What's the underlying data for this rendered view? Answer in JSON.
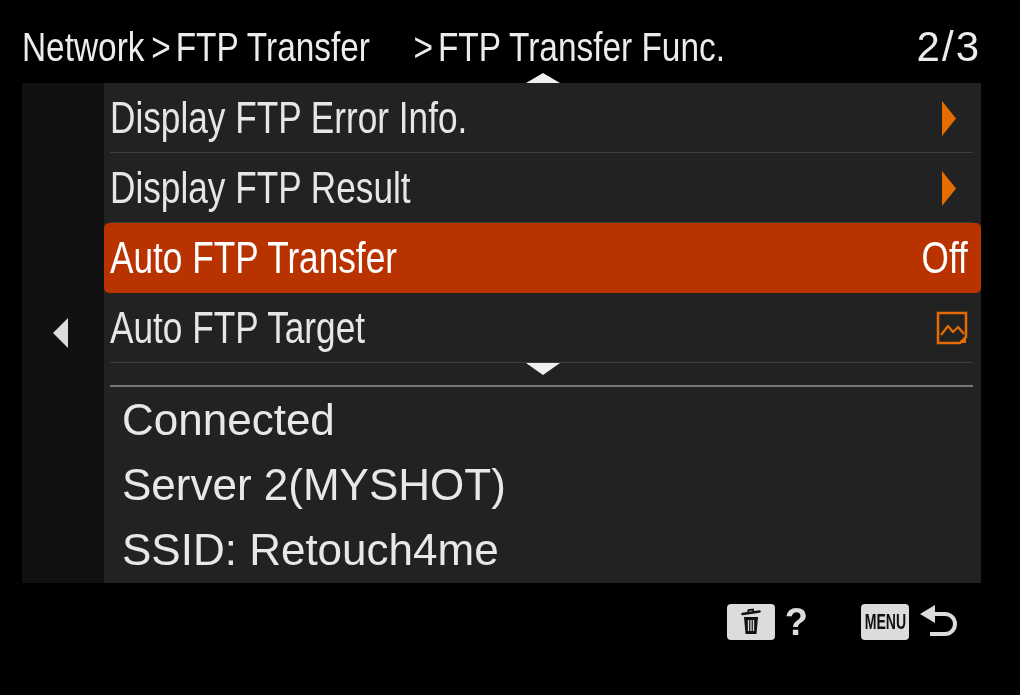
{
  "header": {
    "breadcrumb": [
      {
        "kind": "label",
        "text": "Network"
      },
      {
        "kind": "separator",
        "text": ">"
      },
      {
        "kind": "label",
        "text": "FTP Transfer"
      },
      {
        "kind": "separator",
        "text": ">"
      },
      {
        "kind": "label",
        "text": "FTP Transfer Func."
      }
    ],
    "page": "2/3"
  },
  "menu": {
    "items": [
      {
        "label": "Display FTP Error Info.",
        "kind": "submenu",
        "selected": false
      },
      {
        "label": "Display FTP Result",
        "kind": "submenu",
        "selected": false
      },
      {
        "label": "Auto FTP Transfer",
        "kind": "value",
        "value": "Off",
        "selected": true
      },
      {
        "label": "Auto FTP Target",
        "kind": "image",
        "selected": false
      }
    ]
  },
  "status": [
    "Connected",
    "Server 2(MYSHOT)",
    "SSID: Retouch4me"
  ],
  "footer": {
    "delete_hint": "?",
    "menu_key": "MENU"
  }
}
